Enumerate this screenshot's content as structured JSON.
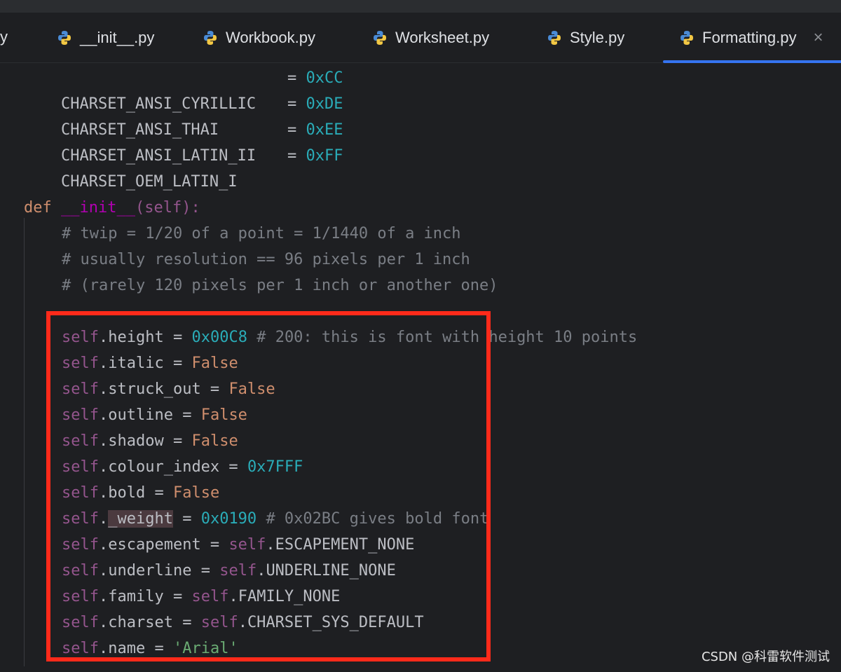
{
  "tabs": {
    "edge_fragment": "y",
    "items": [
      {
        "label": "__init__.py",
        "icon": "python-file-icon",
        "active": false
      },
      {
        "label": "Workbook.py",
        "icon": "python-file-icon",
        "active": false
      },
      {
        "label": "Worksheet.py",
        "icon": "python-file-icon",
        "active": false
      },
      {
        "label": "Style.py",
        "icon": "python-file-icon",
        "active": false
      },
      {
        "label": "Formatting.py",
        "icon": "python-file-icon",
        "active": true
      }
    ],
    "close_glyph": "×"
  },
  "code": {
    "constants": [
      {
        "name": "CHARSET_ANSI_CYRILLIC",
        "value": "0xCC"
      },
      {
        "name": "CHARSET_ANSI_THAI",
        "value": "0xDE"
      },
      {
        "name": "CHARSET_ANSI_LATIN_II",
        "value": "0xEE"
      },
      {
        "name": "CHARSET_OEM_LATIN_I",
        "value": "0xFF"
      }
    ],
    "def_keyword": "def",
    "def_name": "__init__",
    "def_params": "(self):",
    "comments": [
      "# twip = 1/20 of a point = 1/1440 of a inch",
      "# usually resolution == 96 pixels per 1 inch",
      "# (rarely 120 pixels per 1 inch or another one)"
    ],
    "assignments": [
      {
        "attr": "height",
        "value": "0x00C8",
        "kind": "num",
        "comment": "# 200: this is font with height 10 points"
      },
      {
        "attr": "italic",
        "value": "False",
        "kind": "bool",
        "comment": ""
      },
      {
        "attr": "struck_out",
        "value": "False",
        "kind": "bool",
        "comment": ""
      },
      {
        "attr": "outline",
        "value": "False",
        "kind": "bool",
        "comment": ""
      },
      {
        "attr": "shadow",
        "value": "False",
        "kind": "bool",
        "comment": ""
      },
      {
        "attr": "colour_index",
        "value": "0x7FFF",
        "kind": "num",
        "comment": ""
      },
      {
        "attr": "bold",
        "value": "False",
        "kind": "bool",
        "comment": ""
      },
      {
        "attr": "_weight",
        "value": "0x0190",
        "kind": "num",
        "comment": "# 0x02BC gives bold font",
        "highlight": true
      },
      {
        "attr": "escapement",
        "value": "ESCAPEMENT_NONE",
        "kind": "selfref",
        "comment": ""
      },
      {
        "attr": "underline",
        "value": "UNDERLINE_NONE",
        "kind": "selfref",
        "comment": ""
      },
      {
        "attr": "family",
        "value": "FAMILY_NONE",
        "kind": "selfref",
        "comment": ""
      },
      {
        "attr": "charset",
        "value": "CHARSET_SYS_DEFAULT",
        "kind": "selfref",
        "comment": ""
      },
      {
        "attr": "name",
        "value": "'Arial'",
        "kind": "str",
        "comment": ""
      }
    ]
  },
  "annotation": {
    "color": "#ff2a1a"
  },
  "watermark": "CSDN @科雷软件测试"
}
